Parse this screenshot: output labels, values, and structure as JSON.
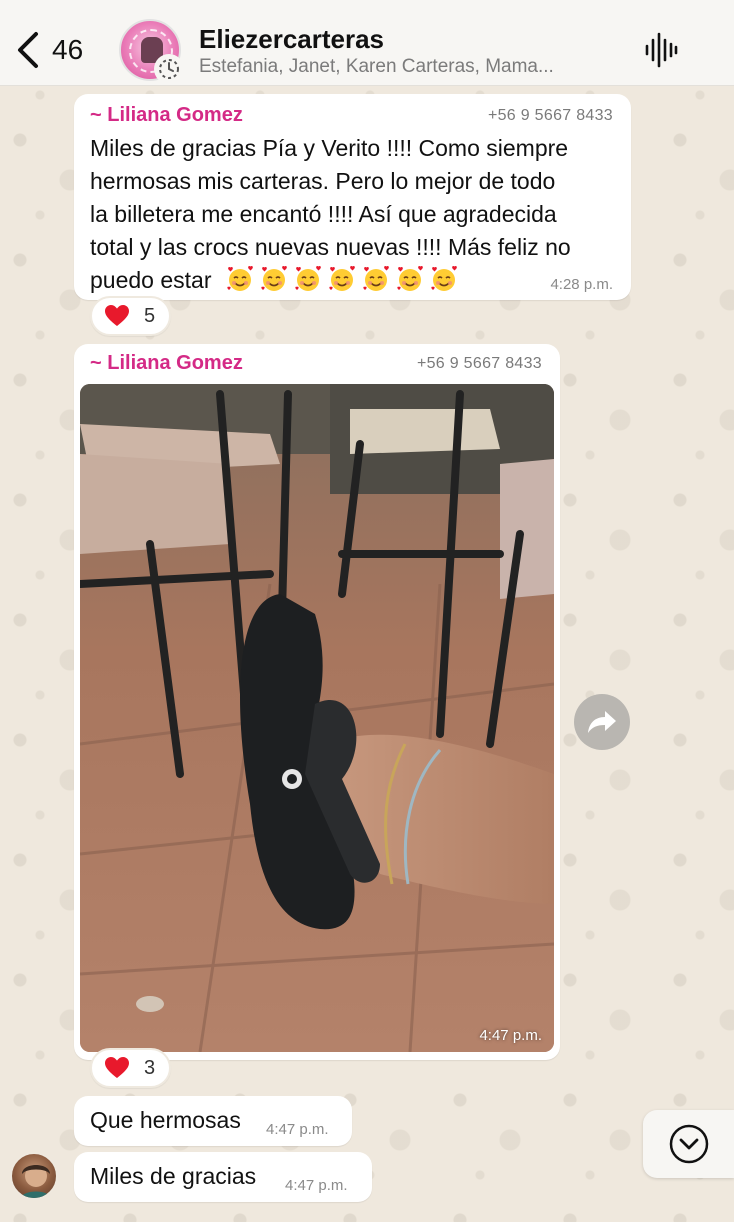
{
  "header": {
    "back_count": "46",
    "title": "Eliezercarteras",
    "subtitle": "Estefania, Janet, Karen Carteras, Mama..."
  },
  "messages": [
    {
      "sender": "~ Liliana Gomez",
      "phone": "+56 9 5667 8433",
      "lines": [
        "Miles de gracias Pía y Verito !!!! Como siempre",
        "hermosas mis carteras. Pero lo mejor de todo",
        "la billetera me encantó !!!! Así que agradecida",
        "total y las crocs nuevas nuevas !!!! Más feliz no",
        "puedo estar"
      ],
      "emoji_count": 7,
      "time": "4:28 p.m.",
      "reaction_emoji": "heart",
      "reaction_count": "5"
    },
    {
      "sender": "~ Liliana Gomez",
      "phone": "+56 9 5667 8433",
      "photo_time": "4:47 p.m.",
      "reaction_emoji": "heart",
      "reaction_count": "3"
    },
    {
      "text": "Que hermosas",
      "time": "4:47 p.m."
    },
    {
      "text": "Miles de gracias",
      "time": "4:47 p.m."
    }
  ],
  "colors": {
    "sender": "#d42a86",
    "heart": "#e8192c",
    "wallpaper": "#efe9df"
  },
  "icons": {
    "back": "chevron-left-icon",
    "voice": "voice-waveform-icon",
    "forward": "forward-arrow-icon",
    "scroll": "chevron-down-circle-icon",
    "community": "community-badge-icon",
    "emoji": "smiling-face-with-hearts"
  }
}
